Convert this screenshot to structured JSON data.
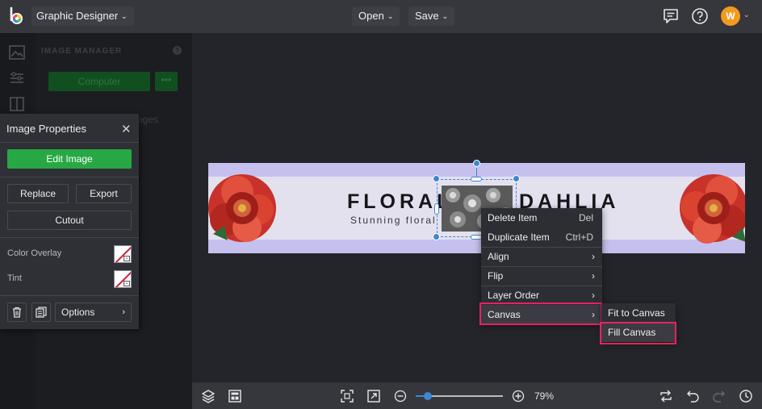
{
  "topbar": {
    "app_name": "Graphic Designer",
    "open_label": "Open",
    "save_label": "Save",
    "avatar_initial": "W"
  },
  "image_manager": {
    "title": "IMAGE MANAGER",
    "computer_label": "Computer",
    "more_label": "•••",
    "tab_label": "ages"
  },
  "image_properties": {
    "title": "Image Properties",
    "edit_label": "Edit Image",
    "replace_label": "Replace",
    "export_label": "Export",
    "cutout_label": "Cutout",
    "color_overlay_label": "Color Overlay",
    "tint_label": "Tint",
    "options_label": "Options"
  },
  "banner": {
    "title_left": "FLORAL",
    "title_right": "DAHLIA",
    "subtitle": "Stunning floral"
  },
  "context_menu": {
    "items": [
      {
        "label": "Delete Item",
        "shortcut": "Del"
      },
      {
        "label": "Duplicate Item",
        "shortcut": "Ctrl+D"
      },
      {
        "label": "Align",
        "arrow": "›"
      },
      {
        "label": "Flip",
        "arrow": "›"
      },
      {
        "label": "Layer Order",
        "arrow": "›"
      },
      {
        "label": "Canvas",
        "arrow": "›"
      }
    ]
  },
  "canvas_submenu": {
    "items": [
      {
        "label": "Fit to Canvas"
      },
      {
        "label": "Fill Canvas"
      }
    ]
  },
  "bottombar": {
    "zoom_value": 0.14,
    "zoom_label": "79%"
  },
  "colors": {
    "accent_green": "#27a844",
    "highlight": "#e8215f",
    "selection": "#3d87d0",
    "avatar": "#f39a1e"
  }
}
